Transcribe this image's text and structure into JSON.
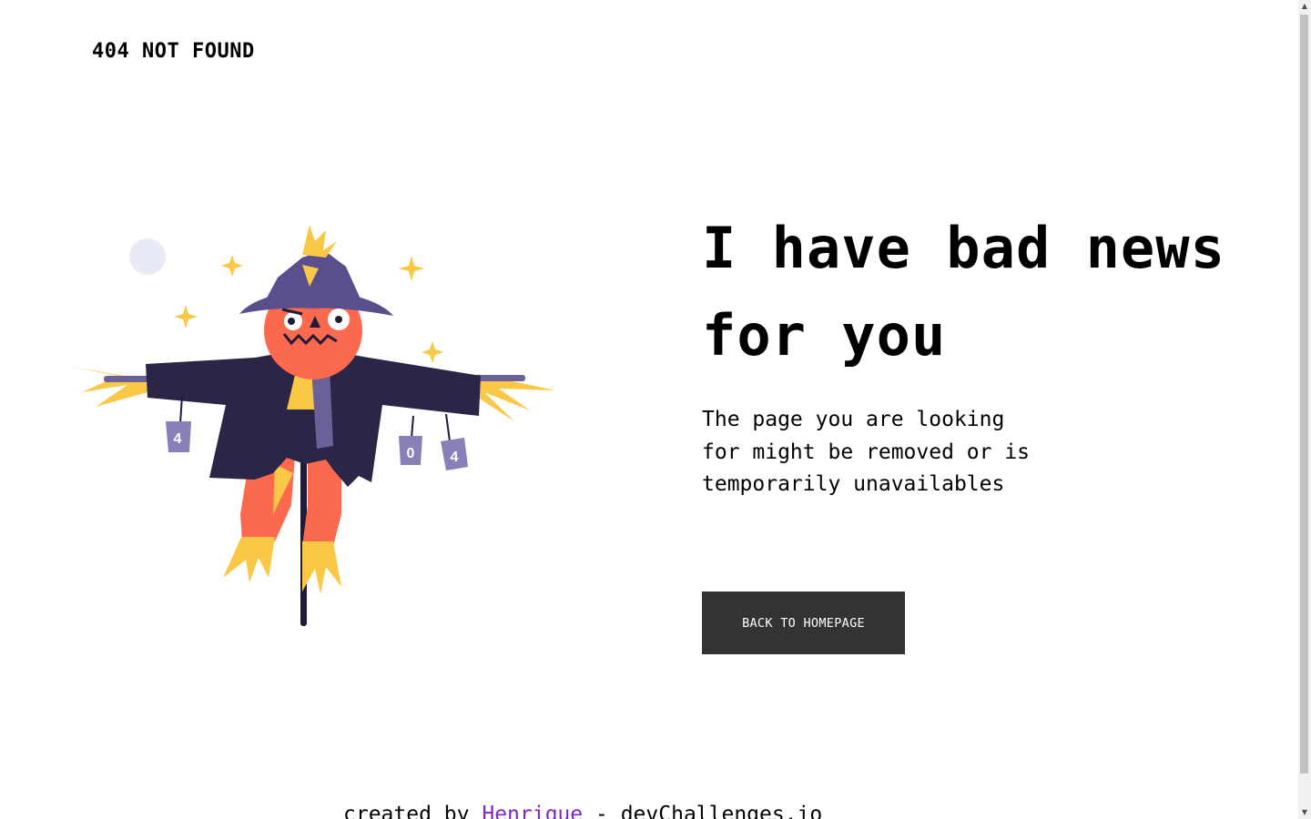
{
  "header": {
    "logo": "404 NOT FOUND"
  },
  "illustration": {
    "name": "scarecrow",
    "can_labels": [
      "4",
      "0",
      "4"
    ],
    "colors": {
      "hat": "#5a4e8c",
      "jacket": "#2b2548",
      "body": "#fb6a4e",
      "straw": "#f9c846",
      "scarf": "#6b6196",
      "can": "#8a7fb6",
      "pole": "#1f1b38",
      "moon": "#e8ebf5"
    }
  },
  "main": {
    "headline": "I have bad news for you",
    "message": "The page you are looking for might be removed or is temporarily unavailables",
    "button_label": "BACK TO HOMEPAGE"
  },
  "footer": {
    "prefix": "created by",
    "author": "Henrique",
    "separator": "-",
    "site": "devChallenges.io"
  },
  "colors": {
    "button_bg": "#333333",
    "button_text": "#ffffff",
    "link": "#7a28cb",
    "text": "#000000"
  }
}
